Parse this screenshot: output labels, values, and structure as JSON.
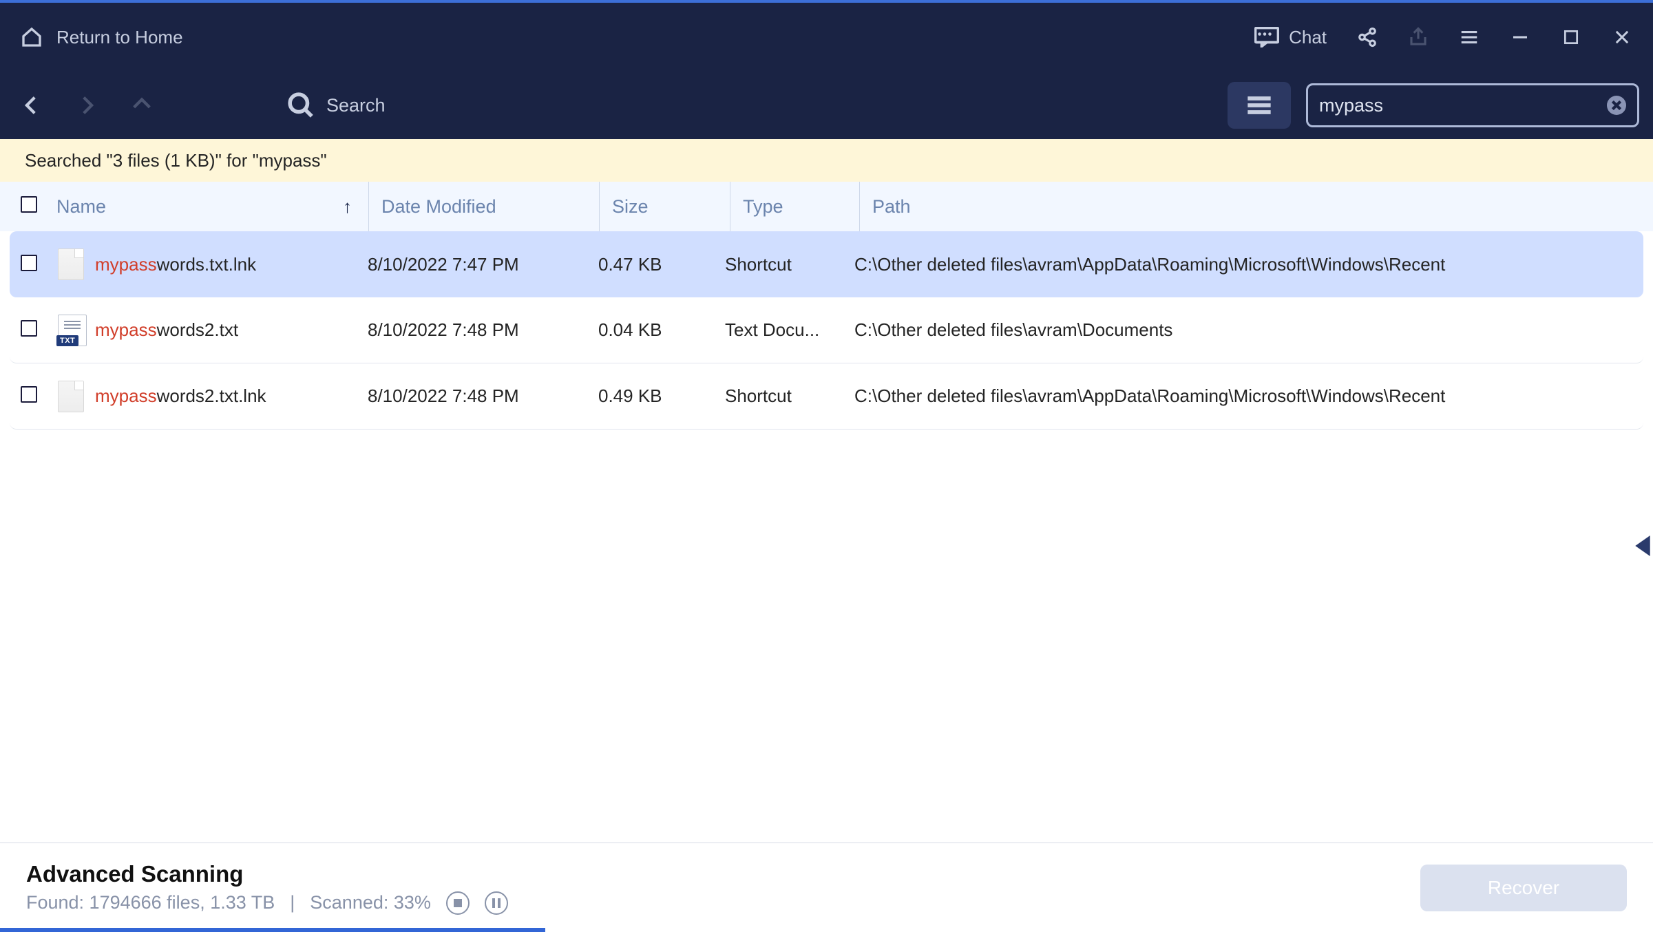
{
  "titlebar": {
    "return_home": "Return to Home",
    "chat": "Chat"
  },
  "toolbar": {
    "search_placeholder": "Search",
    "search_value": "mypass"
  },
  "status": {
    "text": "Searched \"3 files (1 KB)\" for \"mypass\""
  },
  "columns": {
    "name": "Name",
    "date": "Date Modified",
    "size": "Size",
    "type": "Type",
    "path": "Path"
  },
  "rows": [
    {
      "highlight": "mypass",
      "rest": "words.txt.lnk",
      "date": "8/10/2022 7:47 PM",
      "size": "0.47 KB",
      "type": "Shortcut",
      "path": "C:\\Other deleted files\\avram\\AppData\\Roaming\\Microsoft\\Windows\\Recent",
      "icon": "blank",
      "selected": true
    },
    {
      "highlight": "mypass",
      "rest": "words2.txt",
      "date": "8/10/2022 7:48 PM",
      "size": "0.04 KB",
      "type": "Text Docu...",
      "path": "C:\\Other deleted files\\avram\\Documents",
      "icon": "txt",
      "selected": false
    },
    {
      "highlight": "mypass",
      "rest": "words2.txt.lnk",
      "date": "8/10/2022 7:48 PM",
      "size": "0.49 KB",
      "type": "Shortcut",
      "path": "C:\\Other deleted files\\avram\\AppData\\Roaming\\Microsoft\\Windows\\Recent",
      "icon": "blank",
      "selected": false
    }
  ],
  "footer": {
    "title": "Advanced Scanning",
    "found_label": "Found: 1794666 files, 1.33 TB",
    "sep": "|",
    "scanned_label": "Scanned: 33%",
    "recover": "Recover",
    "progress_pct": 33
  }
}
